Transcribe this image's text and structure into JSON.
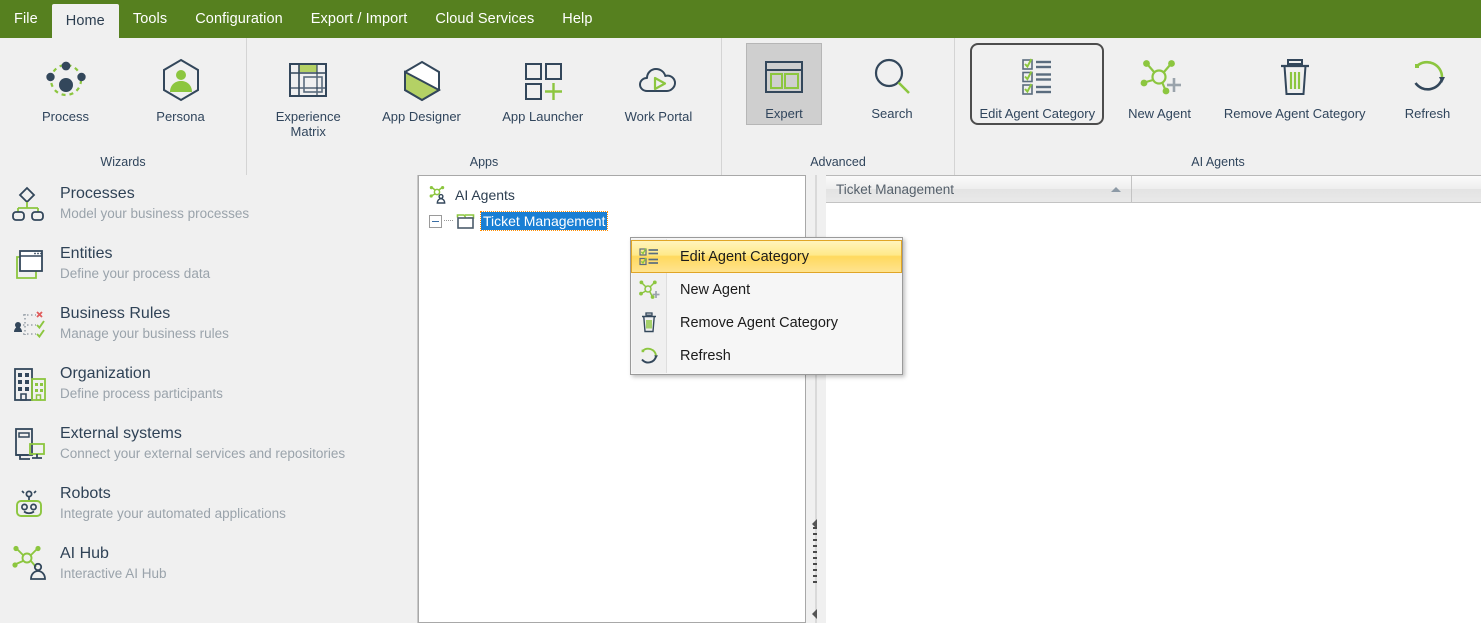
{
  "menubar": {
    "items": [
      {
        "label": "File",
        "active": false
      },
      {
        "label": "Home",
        "active": true
      },
      {
        "label": "Tools",
        "active": false
      },
      {
        "label": "Configuration",
        "active": false
      },
      {
        "label": "Export / Import",
        "active": false
      },
      {
        "label": "Cloud Services",
        "active": false
      },
      {
        "label": "Help",
        "active": false
      }
    ]
  },
  "ribbon": {
    "groups": [
      {
        "label": "Wizards",
        "buttons": [
          {
            "label": "Process",
            "icon": "process-icon",
            "state": "normal"
          },
          {
            "label": "Persona",
            "icon": "persona-icon",
            "state": "normal"
          }
        ]
      },
      {
        "label": "Apps",
        "buttons": [
          {
            "label": "Experience\nMatrix",
            "icon": "experience-matrix-icon",
            "state": "normal"
          },
          {
            "label": "App Designer",
            "icon": "app-designer-icon",
            "state": "normal"
          },
          {
            "label": "App Launcher",
            "icon": "app-launcher-icon",
            "state": "normal"
          },
          {
            "label": "Work Portal",
            "icon": "work-portal-icon",
            "state": "normal"
          }
        ]
      },
      {
        "label": "Advanced",
        "buttons": [
          {
            "label": "Expert",
            "icon": "expert-icon",
            "state": "selected"
          },
          {
            "label": "Search",
            "icon": "search-icon",
            "state": "normal"
          }
        ]
      },
      {
        "label": "AI Agents",
        "buttons": [
          {
            "label": "Edit Agent Category",
            "icon": "edit-agent-category-icon",
            "state": "focused"
          },
          {
            "label": "New Agent",
            "icon": "new-agent-icon",
            "state": "normal"
          },
          {
            "label": "Remove Agent Category",
            "icon": "remove-agent-category-icon",
            "state": "normal"
          },
          {
            "label": "Refresh",
            "icon": "refresh-icon",
            "state": "normal"
          }
        ]
      }
    ]
  },
  "sidebar": {
    "items": [
      {
        "title": "Processes",
        "subtitle": "Model your business processes",
        "icon": "processes-icon"
      },
      {
        "title": "Entities",
        "subtitle": "Define your process data",
        "icon": "entities-icon"
      },
      {
        "title": "Business  Rules",
        "subtitle": "Manage your business rules",
        "icon": "business-rules-icon"
      },
      {
        "title": "Organization",
        "subtitle": "Define process participants",
        "icon": "organization-icon"
      },
      {
        "title": "External systems",
        "subtitle": "Connect your external services and repositories",
        "icon": "external-systems-icon"
      },
      {
        "title": "Robots",
        "subtitle": "Integrate your automated applications",
        "icon": "robots-icon"
      },
      {
        "title": "AI Hub",
        "subtitle": "Interactive AI Hub",
        "icon": "ai-hub-icon"
      }
    ]
  },
  "tree": {
    "root": {
      "label": "AI Agents",
      "icon": "ai-agents-icon"
    },
    "child": {
      "label": "Ticket Management",
      "icon": "folder-icon",
      "selected": true,
      "expander": "minus"
    }
  },
  "grid": {
    "columns": [
      {
        "label": "Ticket Management",
        "sort": "ascending"
      },
      {
        "label": "",
        "sort": "none"
      }
    ]
  },
  "context_menu": {
    "items": [
      {
        "label": "Edit Agent Category",
        "icon": "edit-agent-category-icon",
        "highlighted": true
      },
      {
        "label": "New Agent",
        "icon": "new-agent-icon",
        "highlighted": false
      },
      {
        "label": "Remove Agent Category",
        "icon": "remove-agent-category-icon",
        "highlighted": false
      },
      {
        "label": "Refresh",
        "icon": "refresh-icon",
        "highlighted": false
      }
    ]
  },
  "colors": {
    "brand_green": "#56801f",
    "accent_green": "#8cc63f",
    "icon_navy": "#33475b",
    "selection_blue": "#1a7fd4",
    "focus_orange": "#ff8c00",
    "menu_highlight": "#ffd95e"
  }
}
